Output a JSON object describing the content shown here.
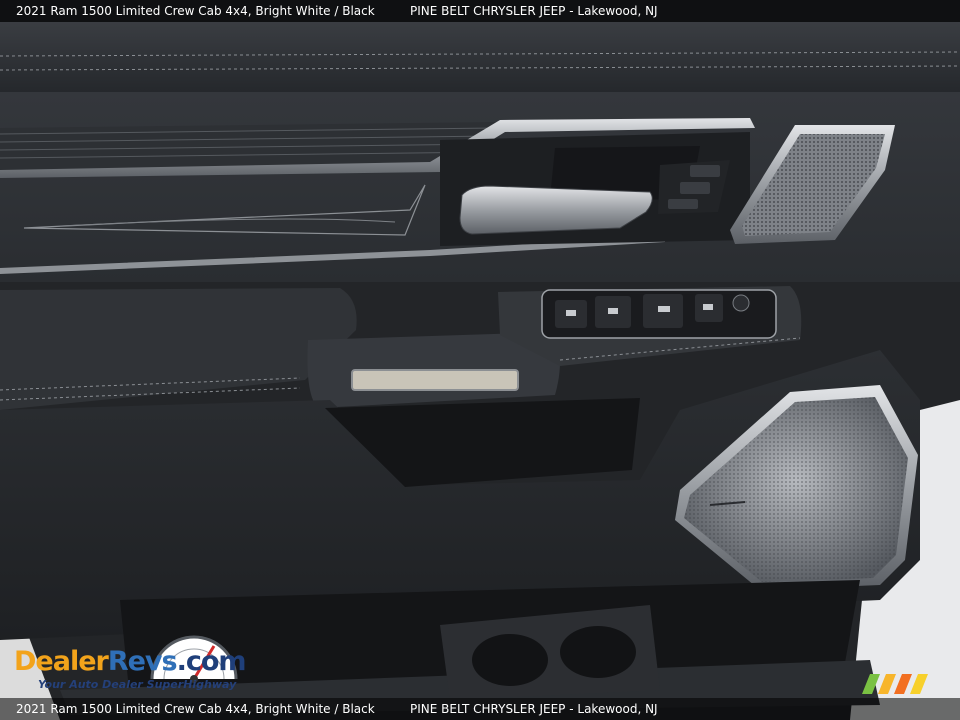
{
  "caption": {
    "vehicle": "2021 Ram 1500 Limited Crew Cab 4x4,  Bright White / Black",
    "dealer": "PINE BELT CHRYSLER JEEP - Lakewood, NJ"
  },
  "watermark": {
    "brand_part1": "Dealer",
    "brand_part2": "Revs",
    "brand_part3": ".com",
    "tagline": "Your Auto Dealer SuperHighway"
  },
  "colors": {
    "panel": "#2a2d31",
    "trim_chrome": "#b9bcc0",
    "caption_bg": "#000000",
    "brand_orange": "#f2a31b",
    "brand_blue": "#2f6fb7"
  },
  "icons": [
    "door-handle-icon",
    "window-switch-icon",
    "speaker-grille-icon",
    "cupholder-icon",
    "gauge-icon"
  ]
}
